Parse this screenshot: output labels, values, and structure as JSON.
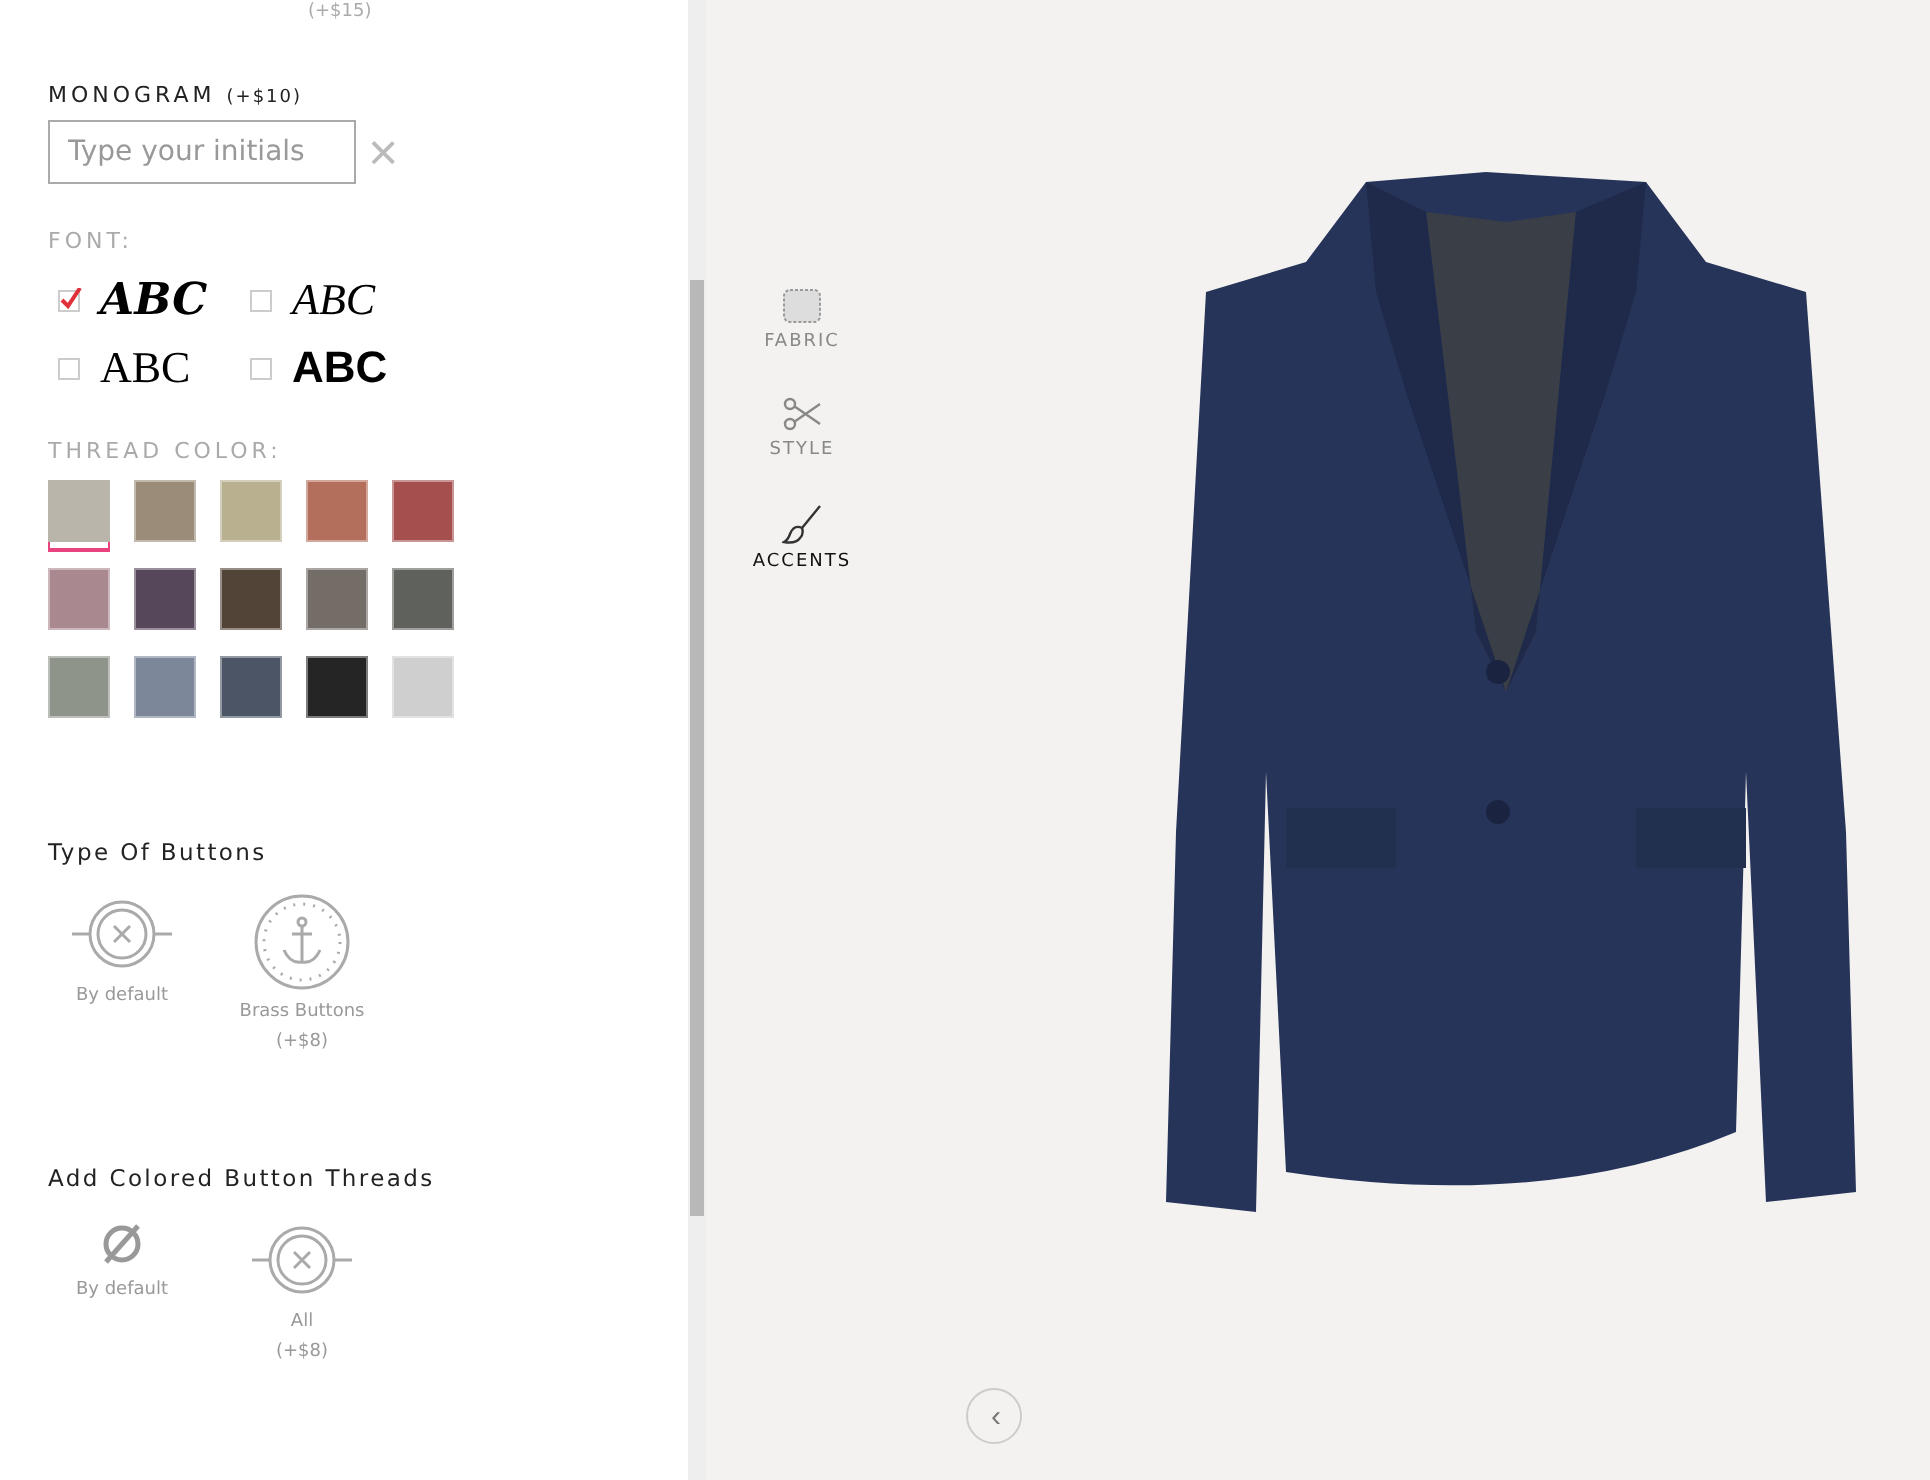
{
  "top_price": "(+$15)",
  "monogram": {
    "title": "MONOGRAM",
    "price": "(+$10)",
    "placeholder": "Type your initials",
    "clear": "×"
  },
  "font": {
    "label": "FONT:",
    "options": [
      {
        "sample": "ABC",
        "kind": "script-bold",
        "checked": true
      },
      {
        "sample": "ABC",
        "kind": "script",
        "checked": false
      },
      {
        "sample": "ABC",
        "kind": "serif",
        "checked": false
      },
      {
        "sample": "ABC",
        "kind": "sans",
        "checked": false
      }
    ]
  },
  "thread_color": {
    "label": "THREAD COLOR:",
    "swatches": [
      {
        "color": "#b9b5aa",
        "selected": true
      },
      {
        "color": "#9a8c78",
        "selected": false
      },
      {
        "color": "#b8b08e",
        "selected": false
      },
      {
        "color": "#b46e5c",
        "selected": false
      },
      {
        "color": "#a5504f",
        "selected": false
      },
      {
        "color": "#a98890",
        "selected": false
      },
      {
        "color": "#57475a",
        "selected": false
      },
      {
        "color": "#524538",
        "selected": false
      },
      {
        "color": "#736c67",
        "selected": false
      },
      {
        "color": "#5f625c",
        "selected": false
      },
      {
        "color": "#8f948b",
        "selected": false
      },
      {
        "color": "#7c889a",
        "selected": false
      },
      {
        "color": "#4c5566",
        "selected": false
      },
      {
        "color": "#252525",
        "selected": false
      },
      {
        "color": "#cfcfcf",
        "selected": false
      }
    ]
  },
  "button_types": {
    "title": "Type Of Buttons",
    "options": [
      {
        "kind": "plain",
        "label": "By default"
      },
      {
        "kind": "anchor",
        "label": "Brass Buttons",
        "price": "(+$8)"
      }
    ]
  },
  "button_threads": {
    "title": "Add Colored Button Threads",
    "options": [
      {
        "kind": "none",
        "label": "By default"
      },
      {
        "kind": "plain",
        "label": "All",
        "price": "(+$8)"
      }
    ]
  },
  "nav": [
    {
      "kind": "fabric",
      "label": "FABRIC",
      "selected": false
    },
    {
      "kind": "style",
      "label": "STYLE",
      "selected": false
    },
    {
      "kind": "accents",
      "label": "ACCENTS",
      "selected": true
    }
  ],
  "collapse": "‹"
}
